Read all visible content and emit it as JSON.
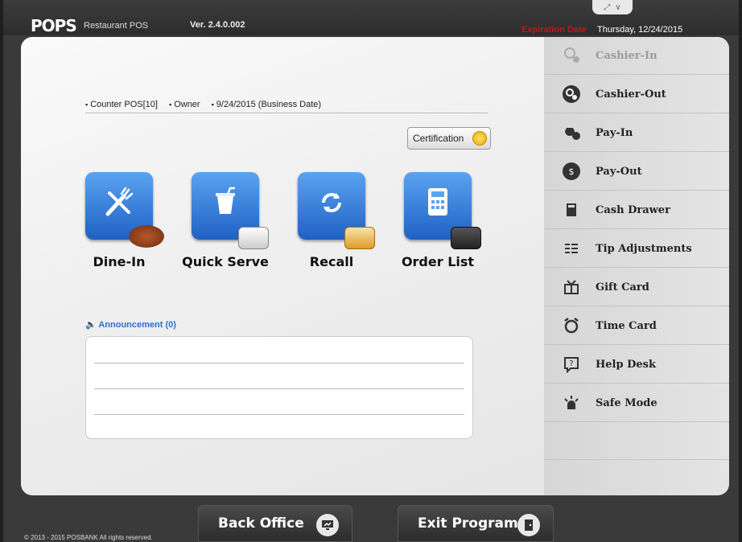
{
  "header": {
    "logo": "POPS",
    "logo_sub": "Restaurant POS",
    "version": "Ver. 2.4.0.002",
    "expiration_label": "Expiration Date",
    "expiration_date": "Thursday, 12/24/2015",
    "tab_restore": "⤢",
    "tab_chevron": "∨"
  },
  "info": {
    "station": "Counter POS[10]",
    "role": "Owner",
    "business_date": "9/24/2015 (Business Date)"
  },
  "certification_label": "Certification",
  "tiles": [
    {
      "label": "Dine-In",
      "icon": "fork-knife-icon"
    },
    {
      "label": "Quick Serve",
      "icon": "drink-cup-icon"
    },
    {
      "label": "Recall",
      "icon": "refresh-icon"
    },
    {
      "label": "Order List",
      "icon": "calculator-icon"
    }
  ],
  "announcement": {
    "label": "Announcement (0)"
  },
  "sidebar": {
    "items": [
      {
        "label": "Cashier-In",
        "icon": "cashier-in-icon",
        "enabled": false
      },
      {
        "label": "Cashier-Out",
        "icon": "cashier-out-icon",
        "enabled": true
      },
      {
        "label": "Pay-In",
        "icon": "pay-in-icon",
        "enabled": true
      },
      {
        "label": "Pay-Out",
        "icon": "pay-out-icon",
        "enabled": true
      },
      {
        "label": "Cash Drawer",
        "icon": "cash-drawer-icon",
        "enabled": true
      },
      {
        "label": "Tip Adjustments",
        "icon": "tip-list-icon",
        "enabled": true
      },
      {
        "label": "Gift Card",
        "icon": "gift-icon",
        "enabled": true
      },
      {
        "label": "Time Card",
        "icon": "alarm-clock-icon",
        "enabled": true
      },
      {
        "label": "Help Desk",
        "icon": "help-icon",
        "enabled": true
      },
      {
        "label": "Safe Mode",
        "icon": "siren-icon",
        "enabled": true
      }
    ]
  },
  "footer": {
    "back_office": "Back Office",
    "exit_program": "Exit Program",
    "copyright": "© 2013 - 2015 POSBANK All rights reserved."
  },
  "colors": {
    "accent_blue": "#1f61c4",
    "expiration_red": "#c0171c",
    "top_bar": "#2d2d2d"
  }
}
